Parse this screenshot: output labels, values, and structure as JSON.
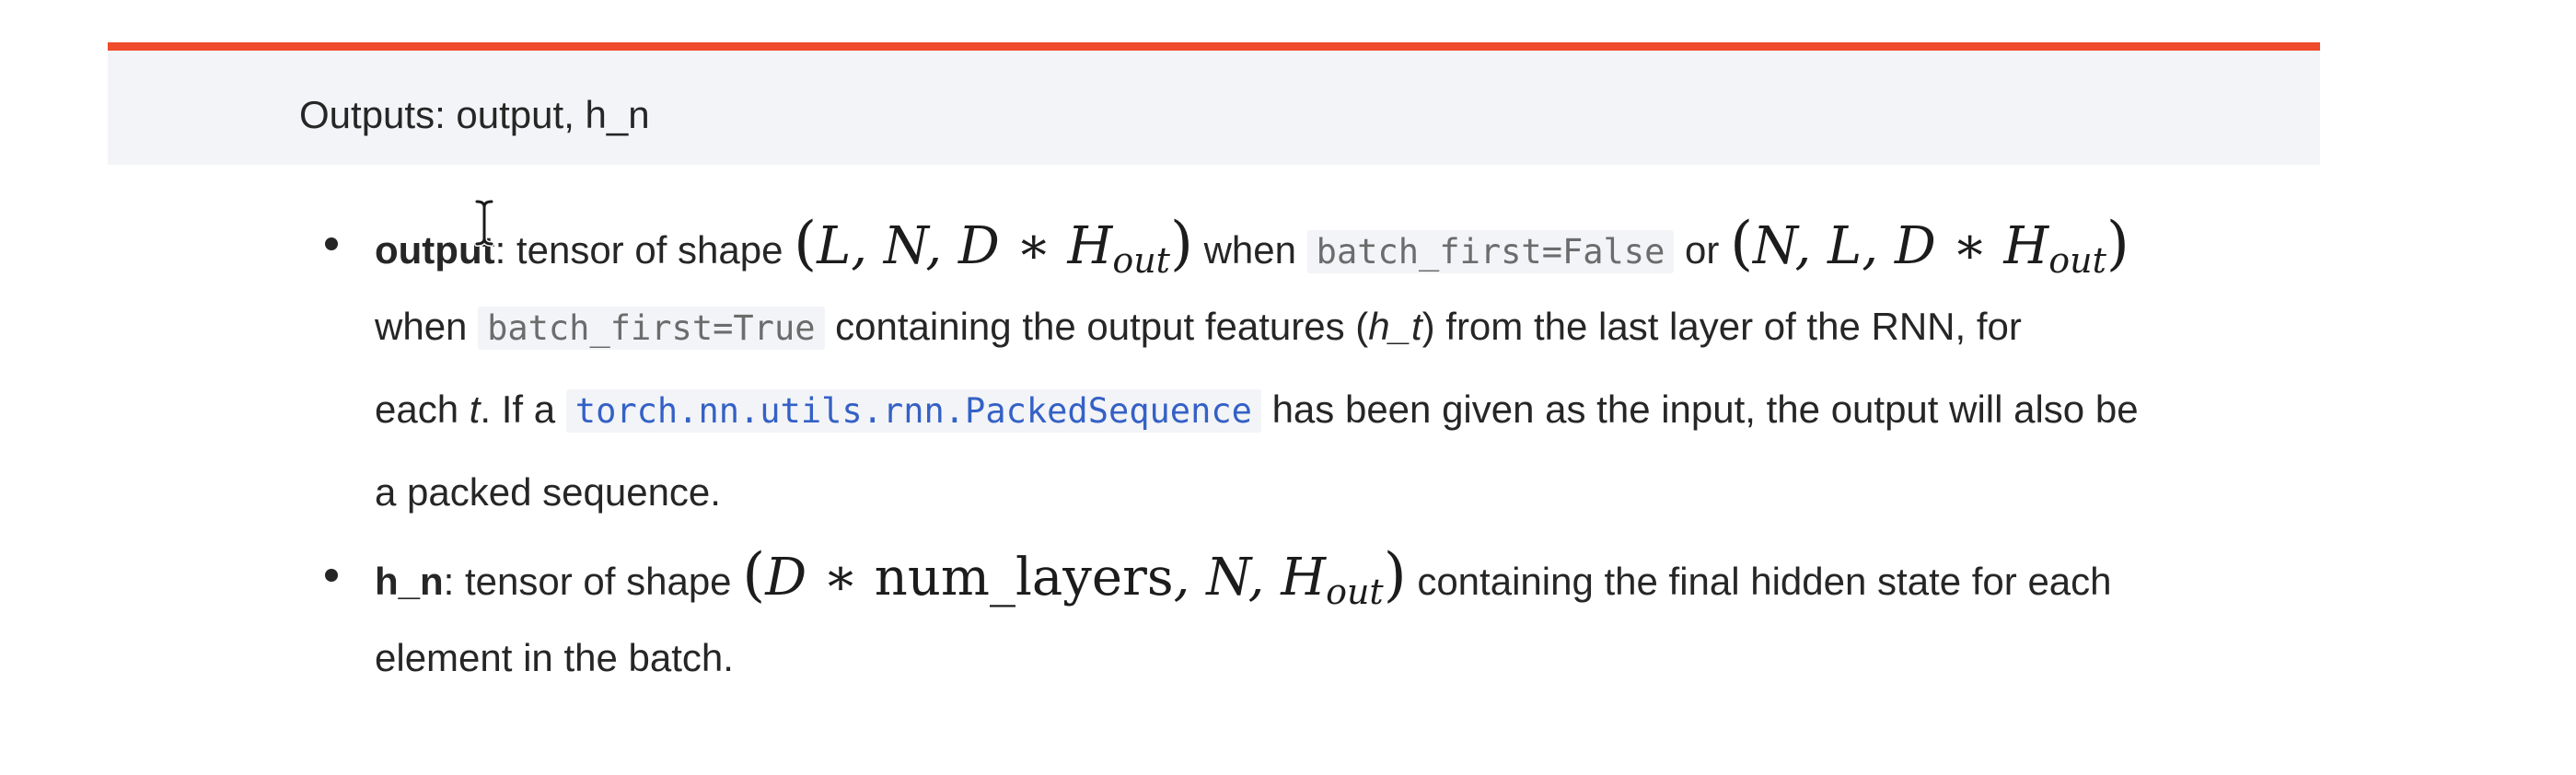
{
  "admonition": {
    "title": "Outputs: output, h_n",
    "accent_color": "#ee4c2c"
  },
  "items": [
    {
      "term": "output",
      "text_1": ": tensor of shape ",
      "math_1": "L, N, D ∗ H",
      "math_1_sub": "out",
      "text_2": " when ",
      "code_1": "batch_first=False",
      "text_3": " or ",
      "math_2": "N, L, D ∗ H",
      "math_2_sub": "out",
      "line2_text_1": "when ",
      "code_2": "batch_first=True",
      "line2_text_2": " containing the output features (",
      "line2_em": "h_t",
      "line2_text_3": ") from the last layer of the RNN, for",
      "line3_text_1": "each ",
      "line3_em": "t",
      "line3_text_2": ". If a ",
      "link": "torch.nn.utils.rnn.PackedSequence",
      "line3_text_3": " has been given as the input, the output will also be",
      "line4_text": "a packed sequence."
    },
    {
      "term": "h_n",
      "text_1": ": tensor of shape ",
      "math_1a": "D",
      "math_1b": " ∗ ",
      "math_1c": "num_layers",
      "math_1d": ", N, H",
      "math_1_sub": "out",
      "text_2": " containing the final hidden state for each",
      "line2_text": "element in the batch."
    }
  ],
  "colors": {
    "text": "#262626",
    "code_bg": "#f3f4f7",
    "code_text": "#6c6c6d",
    "link": "#3461c6",
    "panel_bg": "#f3f4f7"
  },
  "icons": {
    "cursor": "text-cursor-icon"
  }
}
